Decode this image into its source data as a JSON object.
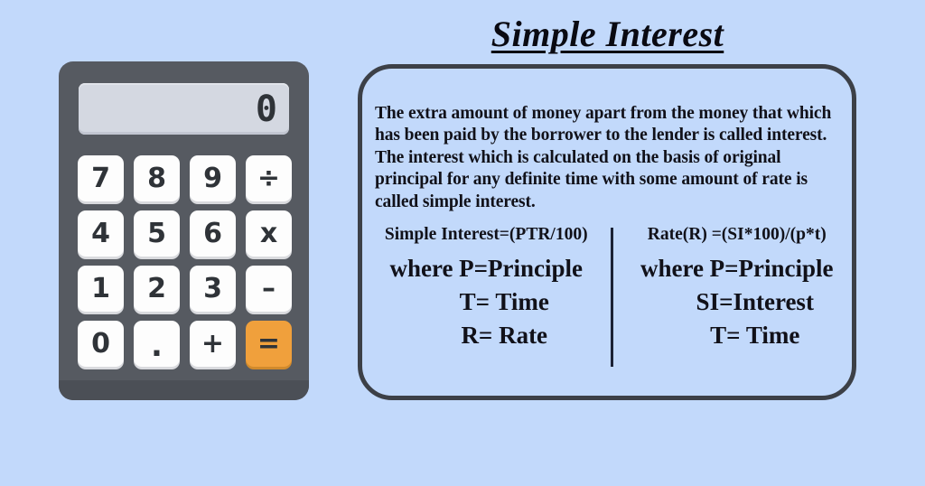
{
  "title": "Simple Interest",
  "calculator": {
    "display_value": "0",
    "keys": [
      {
        "label": "7",
        "name": "calc-key-7",
        "style": "digit"
      },
      {
        "label": "8",
        "name": "calc-key-8",
        "style": "digit"
      },
      {
        "label": "9",
        "name": "calc-key-9",
        "style": "digit"
      },
      {
        "label": "÷",
        "name": "calc-key-divide",
        "style": "operator"
      },
      {
        "label": "4",
        "name": "calc-key-4",
        "style": "digit"
      },
      {
        "label": "5",
        "name": "calc-key-5",
        "style": "digit"
      },
      {
        "label": "6",
        "name": "calc-key-6",
        "style": "digit"
      },
      {
        "label": "x",
        "name": "calc-key-multiply",
        "style": "operator"
      },
      {
        "label": "1",
        "name": "calc-key-1",
        "style": "digit"
      },
      {
        "label": "2",
        "name": "calc-key-2",
        "style": "digit"
      },
      {
        "label": "3",
        "name": "calc-key-3",
        "style": "digit"
      },
      {
        "label": "–",
        "name": "calc-key-minus",
        "style": "operator"
      },
      {
        "label": "0",
        "name": "calc-key-0",
        "style": "digit"
      },
      {
        "label": ".",
        "name": "calc-key-decimal",
        "style": "dot"
      },
      {
        "label": "+",
        "name": "calc-key-plus",
        "style": "operator"
      },
      {
        "label": "=",
        "name": "calc-key-equals",
        "style": "accent"
      }
    ]
  },
  "card": {
    "description": "The extra amount of money apart from the money that which has been paid by the borrower to the lender is called interest. The interest which is calculated on the  basis of original principal for any definite time  with some amount of rate is called simple interest.",
    "formula_left": {
      "heading": "Simple Interest=(PTR/100)",
      "lines": [
        "where P=Principle",
        "T= Time",
        "R= Rate"
      ]
    },
    "formula_right": {
      "heading": "Rate(R) =(SI*100)/(p*t)",
      "lines": [
        "where P=Principle",
        "SI=Interest",
        "T= Time"
      ]
    }
  },
  "colors": {
    "background": "#c2d9fb",
    "calculator_body": "#565a61",
    "calculator_display": "#d4d8e1",
    "key_face": "#fdfdfd",
    "key_accent": "#f0a03c",
    "ink": "#111119",
    "card_border": "#3c4047"
  }
}
